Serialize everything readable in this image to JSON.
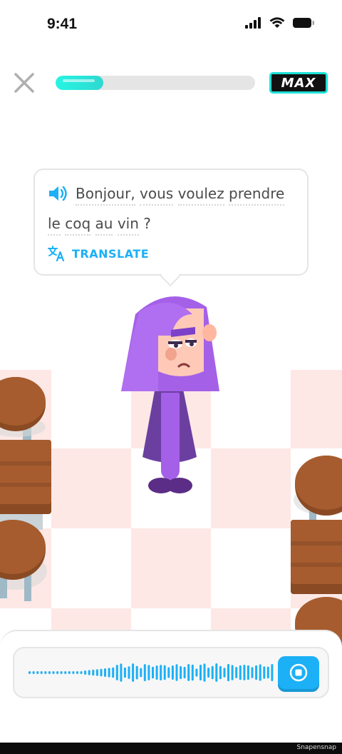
{
  "status_bar": {
    "time": "9:41"
  },
  "header": {
    "progress_fraction": 0.24,
    "badge_label": "MAX"
  },
  "bubble": {
    "line1_words": [
      "Bonjour,",
      "vous",
      "voulez",
      "prendre"
    ],
    "line2_words": [
      "le",
      "coq",
      "au",
      "vin"
    ],
    "line2_end": " ?",
    "translate_label": "TRANSLATE"
  },
  "recorder": {
    "state": "recording"
  },
  "watermark": "Snapensnap",
  "colors": {
    "accent_blue": "#1cb0f6",
    "progress_teal": "#26f5e4",
    "hair_purple": "#a560e8",
    "dress_purple": "#6b3fa0",
    "table_brown": "#a0522d"
  }
}
